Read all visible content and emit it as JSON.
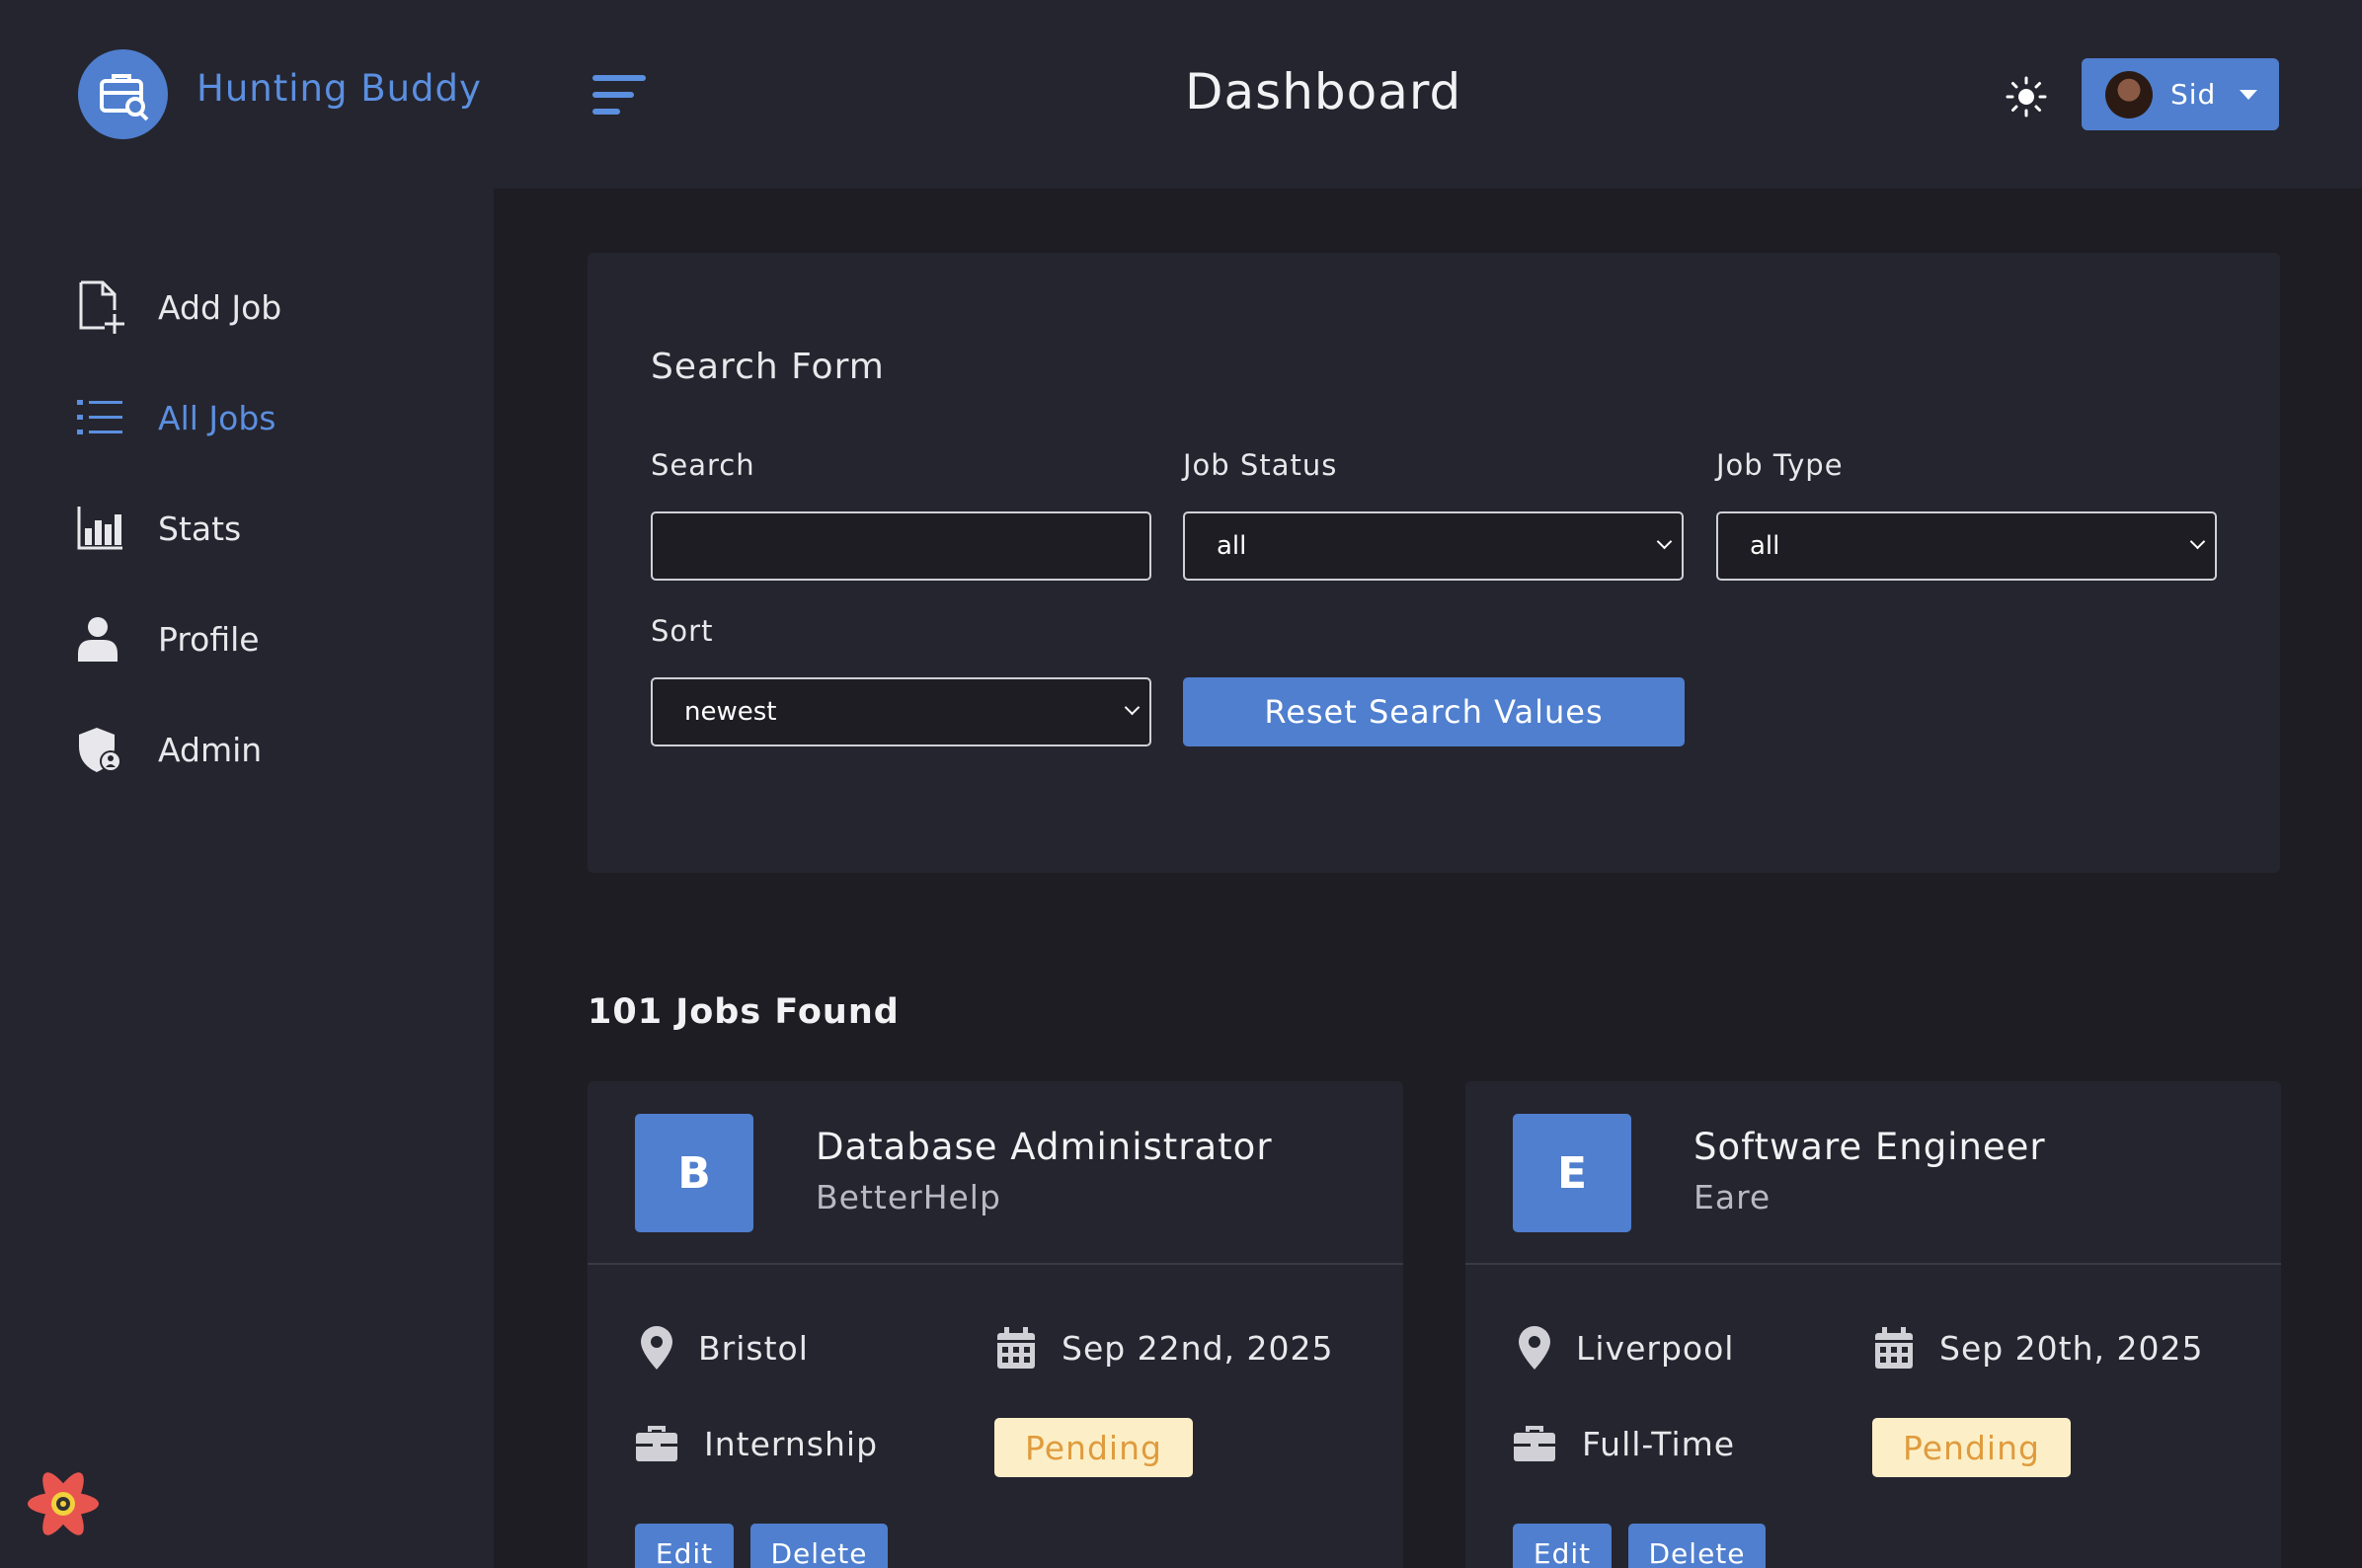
{
  "navbar": {
    "brand": "Hunting Buddy",
    "page_title": "Dashboard",
    "user_name": "Sid"
  },
  "sidebar": {
    "items": [
      {
        "label": "Add Job",
        "icon": "add-file-icon",
        "active": false
      },
      {
        "label": "All Jobs",
        "icon": "list-icon",
        "active": true
      },
      {
        "label": "Stats",
        "icon": "bar-chart-icon",
        "active": false
      },
      {
        "label": "Profile",
        "icon": "user-icon",
        "active": false
      },
      {
        "label": "Admin",
        "icon": "admin-shield-icon",
        "active": false
      }
    ]
  },
  "search_form": {
    "title": "Search Form",
    "search_label": "Search",
    "search_value": "",
    "status_label": "Job Status",
    "status_value": "all",
    "type_label": "Job Type",
    "type_value": "all",
    "sort_label": "Sort",
    "sort_value": "newest",
    "reset_label": "Reset Search Values"
  },
  "jobs_found": "101 Jobs Found",
  "jobs": [
    {
      "initial": "B",
      "position": "Database Administrator",
      "company": "BetterHelp",
      "location": "Bristol",
      "date": "Sep 22nd, 2025",
      "type": "Internship",
      "status": "Pending",
      "edit_label": "Edit",
      "delete_label": "Delete"
    },
    {
      "initial": "E",
      "position": "Software Engineer",
      "company": "Eare",
      "location": "Liverpool",
      "date": "Sep 20th, 2025",
      "type": "Full-Time",
      "status": "Pending",
      "edit_label": "Edit",
      "delete_label": "Delete"
    }
  ],
  "colors": {
    "accent": "#4f7fce",
    "background": "#1d1d23",
    "panel": "#25252f",
    "pending_bg": "#fcefc7",
    "pending_text": "#e09b3d"
  }
}
